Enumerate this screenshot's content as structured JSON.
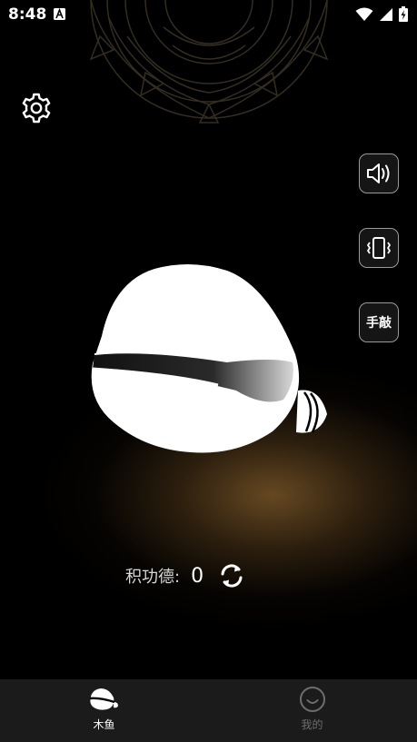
{
  "status_bar": {
    "time": "8:48",
    "app_icon": "accessibility-icon",
    "icons": [
      "wifi-icon",
      "signal-icon",
      "battery-charging-icon"
    ]
  },
  "decor": {
    "mandala": "mandala-pattern"
  },
  "settings": {
    "icon": "gear-icon"
  },
  "side_controls": {
    "sound_icon": "speaker-icon",
    "vibrate_icon": "vibrate-icon",
    "manual_label": "手敲"
  },
  "muyu": {
    "icon": "wooden-fish-icon"
  },
  "merit": {
    "label": "积功德:",
    "value": "0",
    "refresh_icon": "refresh-icon"
  },
  "tabs": [
    {
      "label": "木鱼",
      "icon": "wooden-fish-icon",
      "active": true
    },
    {
      "label": "我的",
      "icon": "smile-icon",
      "active": false
    }
  ],
  "colors": {
    "background": "#000000",
    "glow": "#785528",
    "tabbar_bg": "#1b1b1b",
    "inactive_tab": "#6d6d6d"
  }
}
